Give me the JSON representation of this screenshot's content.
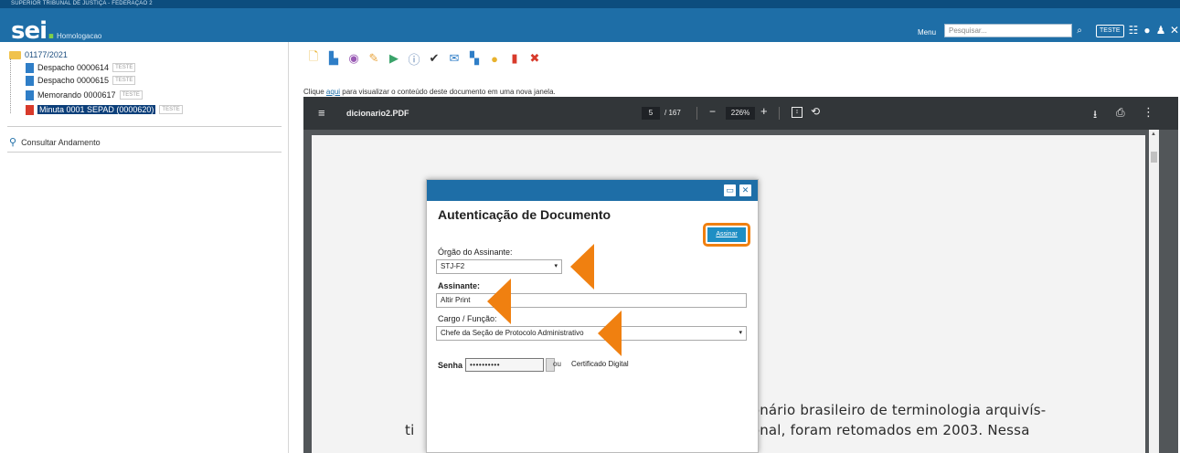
{
  "header": {
    "org_name": "SUPERIOR TRIBUNAL DE JUSTIÇA - FEDERAÇÃO 2",
    "logo_text": "sei",
    "logo_dot": ".",
    "environment": "Homologacao",
    "menu_label": "Menu",
    "search_placeholder": "Pesquisar...",
    "unit_badge": "TESTE",
    "icons": [
      "grid-icon",
      "info-icon",
      "user-icon",
      "tools-icon",
      "logout-icon"
    ]
  },
  "tree": {
    "process_number": "01177/2021",
    "documents": [
      {
        "label": "Despacho 0000614",
        "tag": "TESTE",
        "selected": false
      },
      {
        "label": "Despacho 0000615",
        "tag": "TESTE",
        "selected": false
      },
      {
        "label": "Memorando 0000617",
        "tag": "TESTE",
        "selected": false
      },
      {
        "label": "Minuta 0001 SEPAD (0000620)",
        "tag": "TESTE",
        "selected": true
      }
    ],
    "consult_label": "Consultar Andamento"
  },
  "content": {
    "view_link_prefix": "Clique",
    "view_link_text": "aqui",
    "view_link_suffix": "para visualizar o conteúdo deste documento em uma nova janela."
  },
  "pdf": {
    "filename": "dicionario2.PDF",
    "page": "5",
    "total": "/ 167",
    "zoom": "226%",
    "text_lines": [
      "cionário brasileiro de terminologia arquivís-",
      "ti",
      "cional, foram retomados em 2003. Nessa"
    ]
  },
  "modal": {
    "title": "Autenticação de Documento",
    "sign_button": "Assinar",
    "orgao_label": "Órgão do Assinante:",
    "orgao_value": "STJ-F2",
    "assinante_label": "Assinante:",
    "assinante_value": "Altir Print",
    "cargo_label": "Cargo / Função:",
    "cargo_value": "Chefe da Seção de Protocolo Administrativo",
    "senha_label": "Senha",
    "senha_value": "••••••••••",
    "or_text": "ou",
    "cert_label": "Certificado Digital"
  },
  "colors": {
    "header": "#1e6ea7",
    "accent": "#f08010",
    "button": "#1e8ec4"
  }
}
